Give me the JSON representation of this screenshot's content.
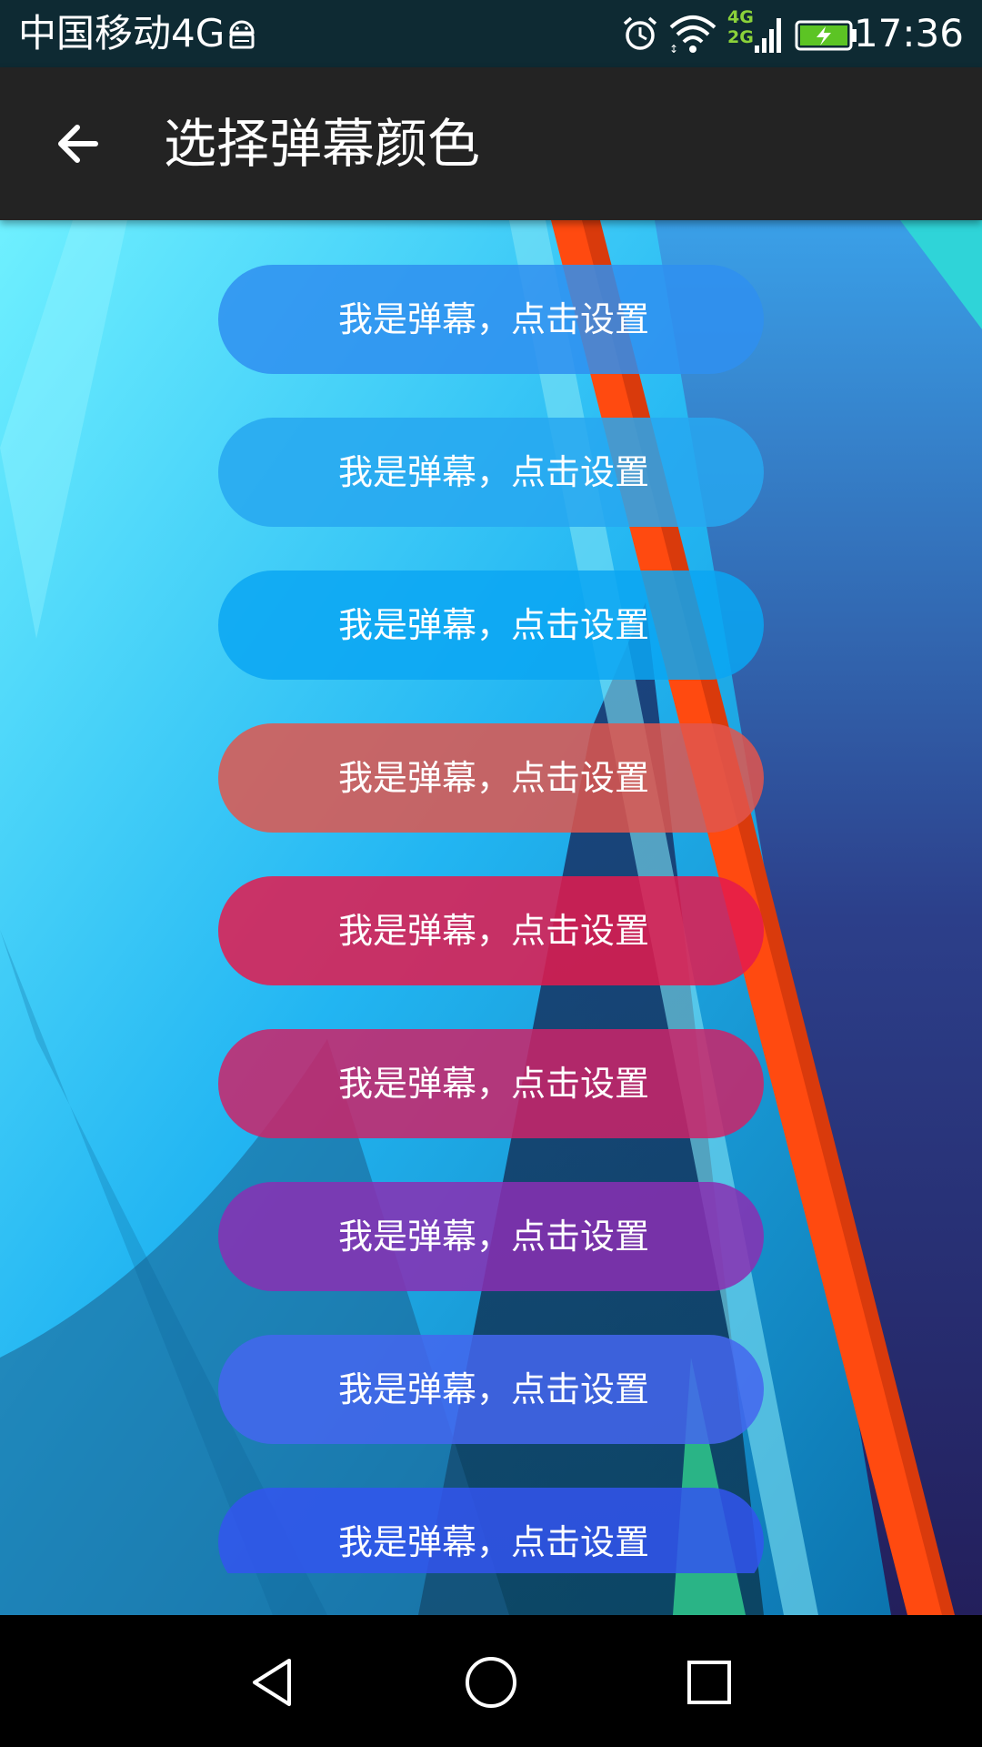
{
  "status_bar": {
    "carrier": "中国移动4G",
    "network_type_top": "4G",
    "network_type_bottom": "2G",
    "time": "17:36",
    "icons": [
      "android-icon",
      "alarm-icon",
      "wifi-icon",
      "signal-icon",
      "battery-charging-icon"
    ]
  },
  "app_bar": {
    "back_icon": "arrow-left-icon",
    "title": "选择弹幕颜色"
  },
  "buttons": [
    {
      "label": "我是弹幕，点击设置",
      "color": "#2f8ff0"
    },
    {
      "label": "我是弹幕，点击设置",
      "color": "#27a7f0"
    },
    {
      "label": "我是弹幕，点击设置",
      "color": "#0aa6f2"
    },
    {
      "label": "我是弹幕，点击设置",
      "color": "#e0564e"
    },
    {
      "label": "我是弹幕，点击设置",
      "color": "#e41a4d"
    },
    {
      "label": "我是弹幕，点击设置",
      "color": "#cc2368"
    },
    {
      "label": "我是弹幕，点击设置",
      "color": "#8a2fb3"
    },
    {
      "label": "我是弹幕，点击设置",
      "color": "#4466ee"
    },
    {
      "label": "我是弹幕，点击设置",
      "color": "#3355ee"
    }
  ],
  "nav_bar": {
    "back": "triangle-back-icon",
    "home": "circle-home-icon",
    "recents": "square-recents-icon"
  }
}
